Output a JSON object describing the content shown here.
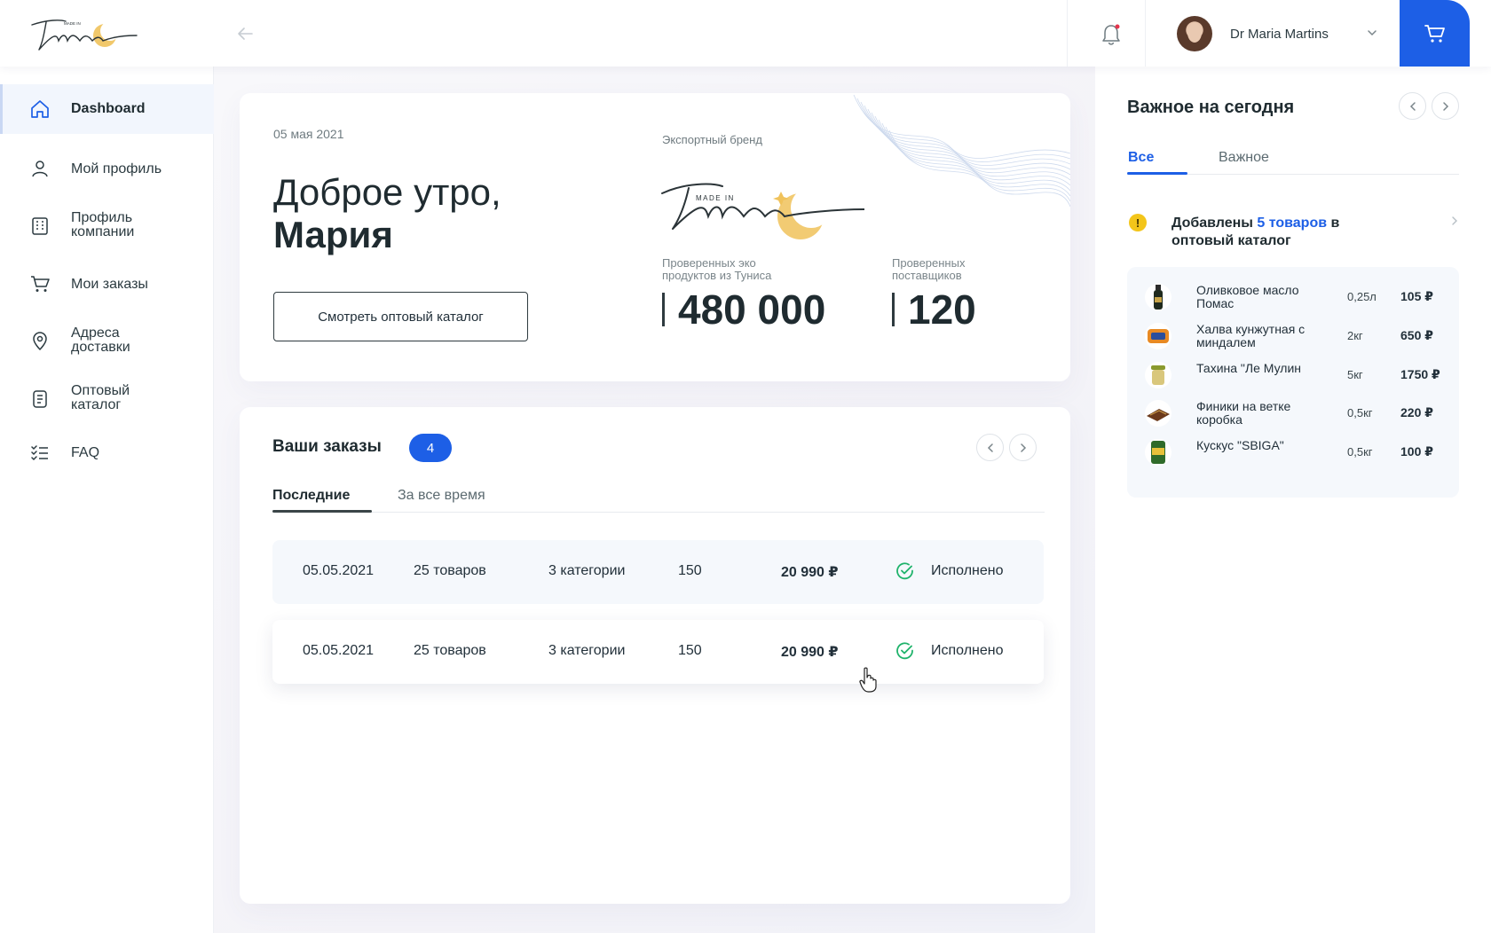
{
  "header": {
    "logo_small": "MADE IN",
    "logo_script": "Tunisia",
    "user_name": "Dr Maria Martins"
  },
  "sidebar": {
    "items": [
      {
        "label": "Dashboard",
        "icon": "home-icon",
        "active": true
      },
      {
        "label": "Мой профиль",
        "icon": "user-icon"
      },
      {
        "label": "Профиль компании",
        "icon": "building-icon"
      },
      {
        "label": "Мои заказы",
        "icon": "cart-icon"
      },
      {
        "label": "Адреса доставки",
        "icon": "location-pin-icon"
      },
      {
        "label": "Оптовый каталог",
        "icon": "document-icon"
      },
      {
        "label": "FAQ",
        "icon": "checklist-icon"
      }
    ]
  },
  "hero": {
    "date": "05 мая 2021",
    "greeting": "Доброе утро,",
    "name": "Мария",
    "catalog_button": "Смотреть оптовый каталог",
    "brand_label": "Экспортный бренд",
    "brand_logo_small": "MADE IN",
    "brand_logo_script": "Tunisia",
    "stats": [
      {
        "label": "Проверенных эко продуктов из Туниса",
        "value": "480 000"
      },
      {
        "label": "Проверенных поставщиков",
        "value": "120"
      }
    ]
  },
  "orders": {
    "title": "Ваши заказы",
    "count": "4",
    "tabs": [
      {
        "label": "Последние",
        "active": true
      },
      {
        "label": "За все время"
      }
    ],
    "rows": [
      {
        "date": "05.05.2021",
        "items": "25 товаров",
        "categories": "3 категории",
        "quantity": "150",
        "total": "20 990 ₽",
        "status": "Исполнено"
      },
      {
        "date": "05.05.2021",
        "items": "25 товаров",
        "categories": "3 категории",
        "quantity": "150",
        "total": "20 990 ₽",
        "status": "Исполнено"
      }
    ]
  },
  "today": {
    "title": "Важное на сегодня",
    "tabs": [
      {
        "label": "Все",
        "active": true
      },
      {
        "label": "Важное"
      }
    ],
    "notice": {
      "prefix": "Добавлены",
      "link": "5 товаров",
      "suffix": "в оптовый каталог"
    },
    "products": [
      {
        "name": "Оливковое масло Помас",
        "qty": "0,25л",
        "price": "105 ₽"
      },
      {
        "name": "Халва кунжутная с миндалем",
        "qty": "2кг",
        "price": "650 ₽"
      },
      {
        "name": "Тахина \"Ле Мулин",
        "qty": "5кг",
        "price": "1750 ₽"
      },
      {
        "name": "Финики на ветке коробка",
        "qty": "0,5кг",
        "price": "220 ₽"
      },
      {
        "name": "Кускус \"SBIGA\"",
        "qty": "0,5кг",
        "price": "100 ₽"
      }
    ]
  },
  "colors": {
    "accent": "#1d5fe6",
    "status_ok": "#1fb36b",
    "warning": "#f3c51a",
    "logo_gold": "#f0c25b"
  }
}
